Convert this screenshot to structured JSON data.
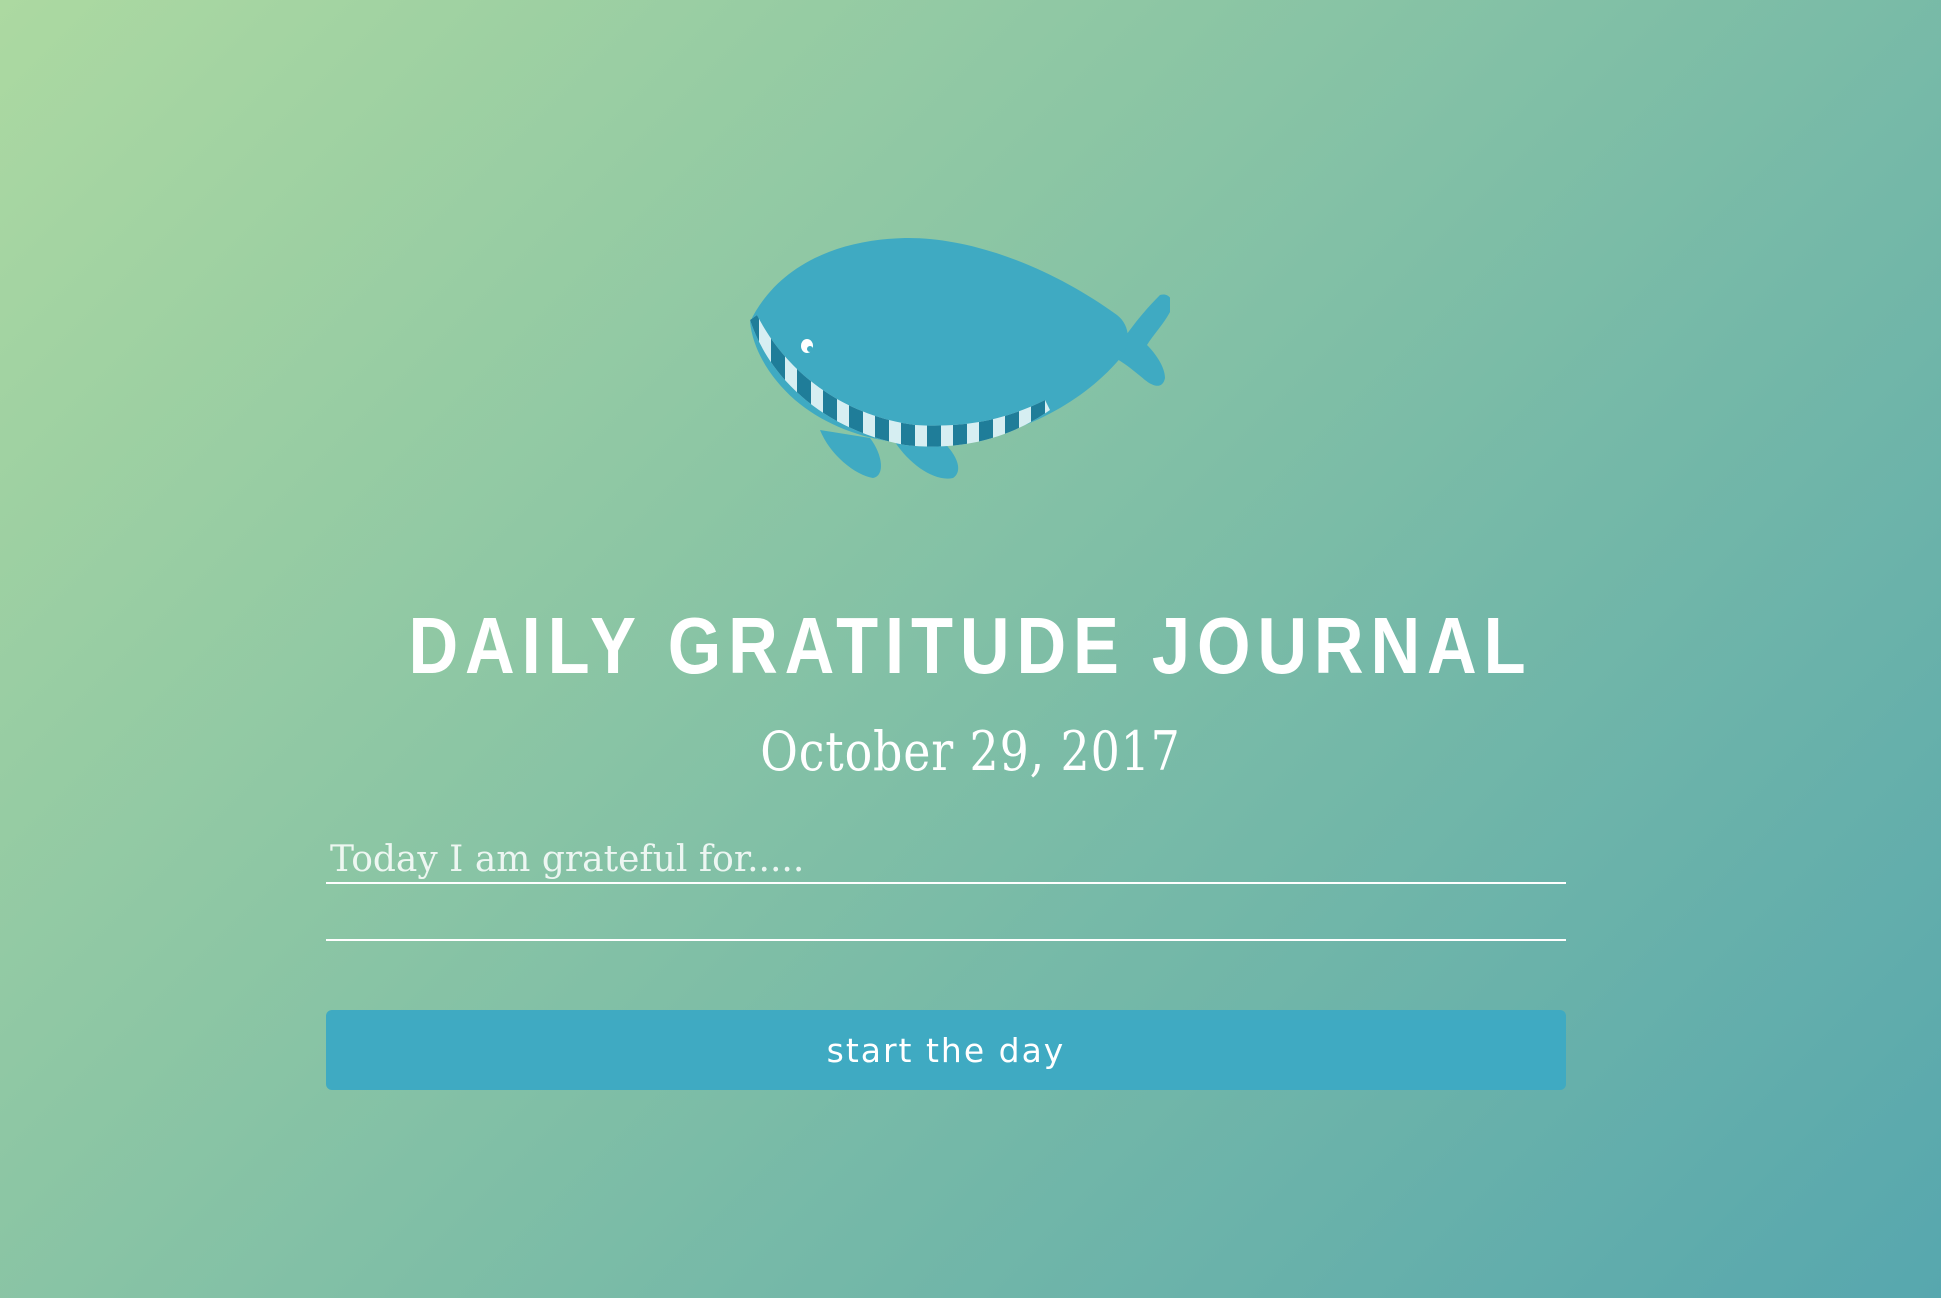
{
  "journal": {
    "title": "DAILY GRATITUDE JOURNAL",
    "date": "October 29, 2017",
    "entry_1_placeholder": "Today I am grateful for.....",
    "entry_1_value": "",
    "entry_2_value": "",
    "submit_label": "start the day"
  },
  "icons": {
    "logo": "whale-icon"
  },
  "colors": {
    "whale_body": "#3faac2",
    "whale_stripe_dark": "#1f7d99",
    "whale_stripe_light": "#d6eef2",
    "button": "#3faac2",
    "text": "#ffffff",
    "gradient_start": "#acd9a1",
    "gradient_end": "#57a7ae"
  }
}
